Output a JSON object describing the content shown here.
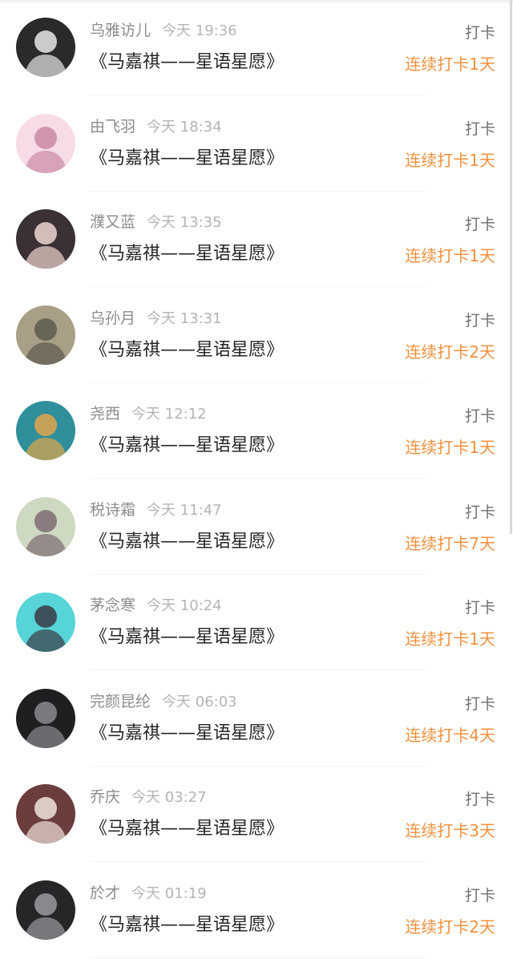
{
  "action_label": "打卡",
  "entries": [
    {
      "name": "乌雅访儿",
      "time": "今天 19:36",
      "title": "《马嘉祺——星语星愿》",
      "streak": "连续打卡1天",
      "avatar": "avatar-bw-boy",
      "bg": "#2a2a2a",
      "fg": "#e8e8e8"
    },
    {
      "name": "由飞羽",
      "time": "今天 18:34",
      "title": "《马嘉祺——星语星愿》",
      "streak": "连续打卡1天",
      "avatar": "avatar-pink-anime-girl",
      "bg": "#f7dbe6",
      "fg": "#c98aa6"
    },
    {
      "name": "濮又蓝",
      "time": "今天 13:35",
      "title": "《马嘉祺——星语星愿》",
      "streak": "连续打卡1天",
      "avatar": "avatar-girl-photo",
      "bg": "#3b3135",
      "fg": "#efd6cf"
    },
    {
      "name": "乌孙月",
      "time": "今天 13:31",
      "title": "《马嘉祺——星语星愿》",
      "streak": "连续打卡2天",
      "avatar": "avatar-seated-person",
      "bg": "#a89f86",
      "fg": "#5d5a4e"
    },
    {
      "name": "尧西",
      "time": "今天 12:12",
      "title": "《马嘉祺——星语星愿》",
      "streak": "连续打卡1天",
      "avatar": "avatar-teal-cartoon",
      "bg": "#2f8f9b",
      "fg": "#e0a64d"
    },
    {
      "name": "税诗霜",
      "time": "今天 11:47",
      "title": "《马嘉祺——星语星愿》",
      "streak": "连续打卡7天",
      "avatar": "avatar-girl-flowers",
      "bg": "#cdd9c1",
      "fg": "#7e6b72"
    },
    {
      "name": "茅念寒",
      "time": "今天 10:24",
      "title": "《马嘉祺——星语星愿》",
      "streak": "连续打卡1天",
      "avatar": "avatar-cyan-anime",
      "bg": "#56d4d8",
      "fg": "#3a3a44"
    },
    {
      "name": "完颜昆纶",
      "time": "今天 06:03",
      "title": "《马嘉祺——星语星愿》",
      "streak": "连续打卡4天",
      "avatar": "avatar-dark-boy",
      "bg": "#1f1f22",
      "fg": "#8a8a90"
    },
    {
      "name": "乔庆",
      "time": "今天 03:27",
      "title": "《马嘉祺——星语星愿》",
      "streak": "连续打卡3天",
      "avatar": "avatar-hanfu-girl",
      "bg": "#6b3d3d",
      "fg": "#f0e3dc"
    },
    {
      "name": "於才",
      "time": "今天 01:19",
      "title": "《马嘉祺——星语星愿》",
      "streak": "连续打卡2天",
      "avatar": "avatar-dark-portrait",
      "bg": "#262628",
      "fg": "#9a9aa0"
    }
  ]
}
